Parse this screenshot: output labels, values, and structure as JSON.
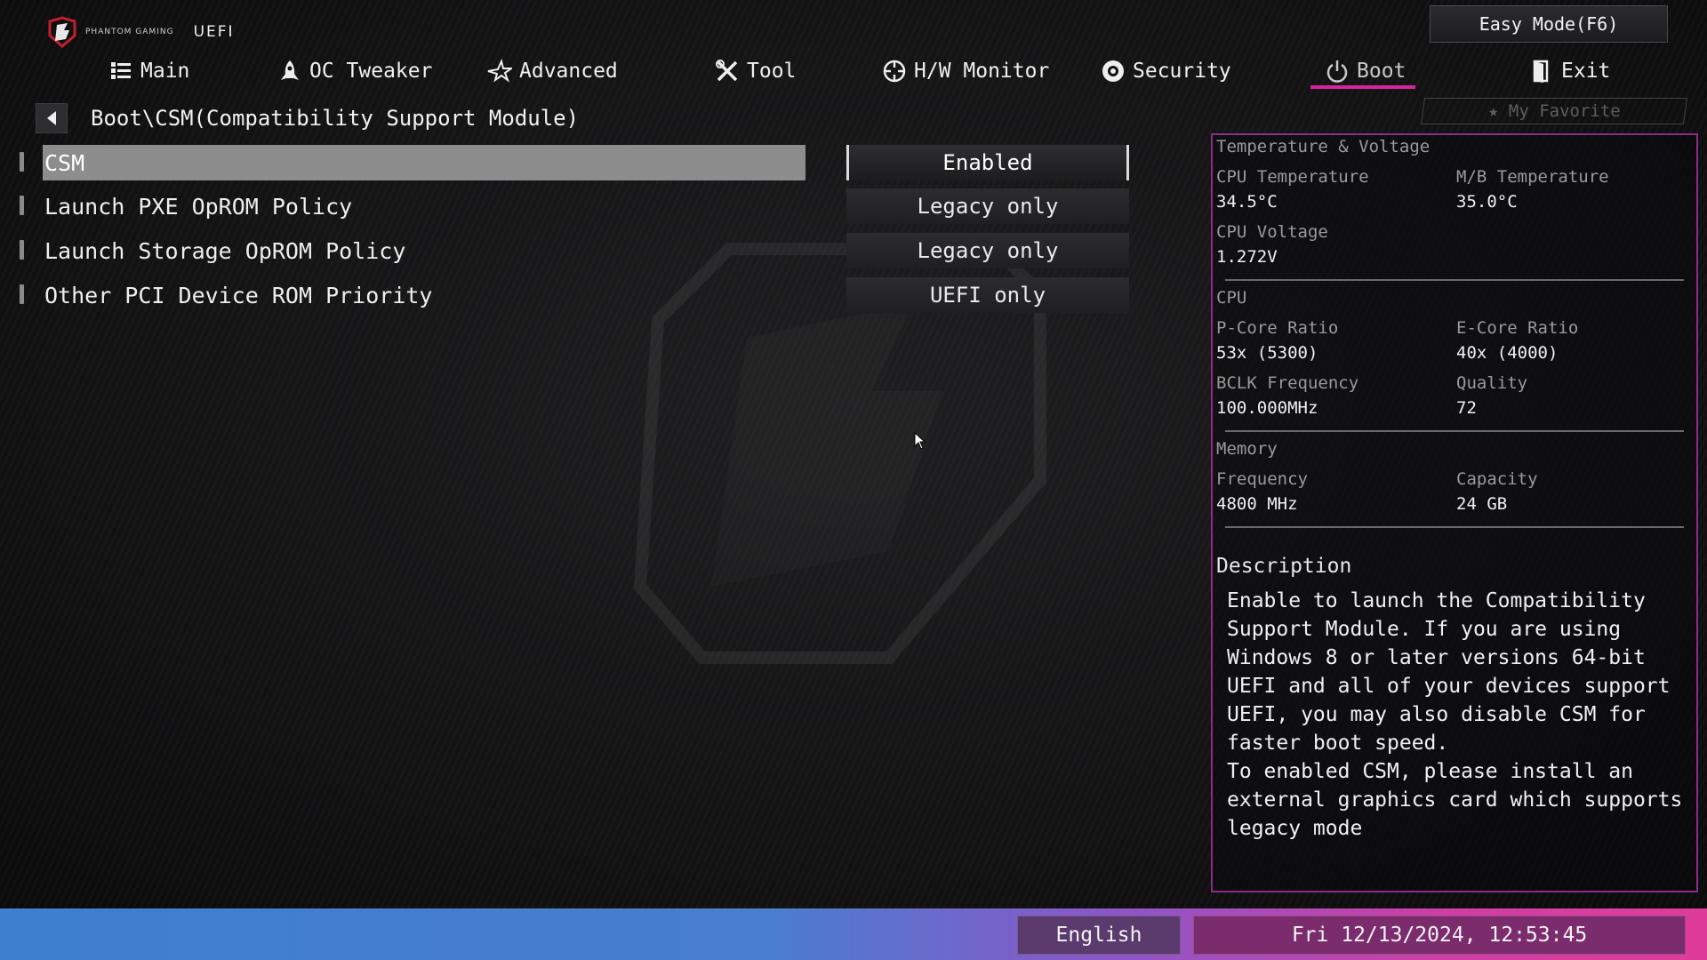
{
  "brand": {
    "logo_text": "PHANTOM GAMING",
    "uefi_label": "UEFI"
  },
  "easy_mode_label": "Easy Mode(F6)",
  "nav": {
    "tabs": [
      {
        "label": "Main",
        "icon": "list-icon"
      },
      {
        "label": "OC Tweaker",
        "icon": "rocket-icon"
      },
      {
        "label": "Advanced",
        "icon": "star-icon"
      },
      {
        "label": "Tool",
        "icon": "tools-icon"
      },
      {
        "label": "H/W Monitor",
        "icon": "crosshair-icon"
      },
      {
        "label": "Security",
        "icon": "shield-icon"
      },
      {
        "label": "Boot",
        "icon": "power-icon",
        "active": true
      },
      {
        "label": "Exit",
        "icon": "door-icon"
      }
    ],
    "active_color": "#d6259a"
  },
  "breadcrumb": "Boot\\CSM(Compatibility Support Module)",
  "favorite_label": "My Favorite",
  "settings": [
    {
      "label": "CSM",
      "value": "Enabled",
      "selected": true
    },
    {
      "label": "Launch PXE OpROM Policy",
      "value": "Legacy only"
    },
    {
      "label": "Launch Storage OpROM Policy",
      "value": "Legacy only"
    },
    {
      "label": "Other PCI Device ROM Priority",
      "value": "UEFI only"
    }
  ],
  "panel": {
    "title": "Temperature & Voltage",
    "cpu_temp_label": "CPU Temperature",
    "cpu_temp": "34.5°C",
    "mb_temp_label": "M/B Temperature",
    "mb_temp": "35.0°C",
    "cpu_voltage_label": "CPU Voltage",
    "cpu_voltage": "1.272V",
    "cpu_title": "CPU",
    "pcore_label": "P-Core Ratio",
    "pcore": "53x (5300)",
    "ecore_label": "E-Core Ratio",
    "ecore": "40x (4000)",
    "bclk_label": "BCLK Frequency",
    "bclk": "100.000MHz",
    "quality_label": "Quality",
    "quality": "72",
    "memory_title": "Memory",
    "freq_label": "Frequency",
    "freq": "4800 MHz",
    "capacity_label": "Capacity",
    "capacity": "24 GB",
    "desc_title": "Description",
    "desc_text": "Enable to launch the Compatibility\nSupport Module. If you are using\nWindows 8 or later versions 64-bit\nUEFI and all of your devices support\nUEFI, you may also disable CSM for\nfaster boot speed.\nTo enabled CSM, please install an\nexternal graphics card which supports\nlegacy mode"
  },
  "footer": {
    "language": "English",
    "datetime": "Fri 12/13/2024, 12:53:45"
  }
}
